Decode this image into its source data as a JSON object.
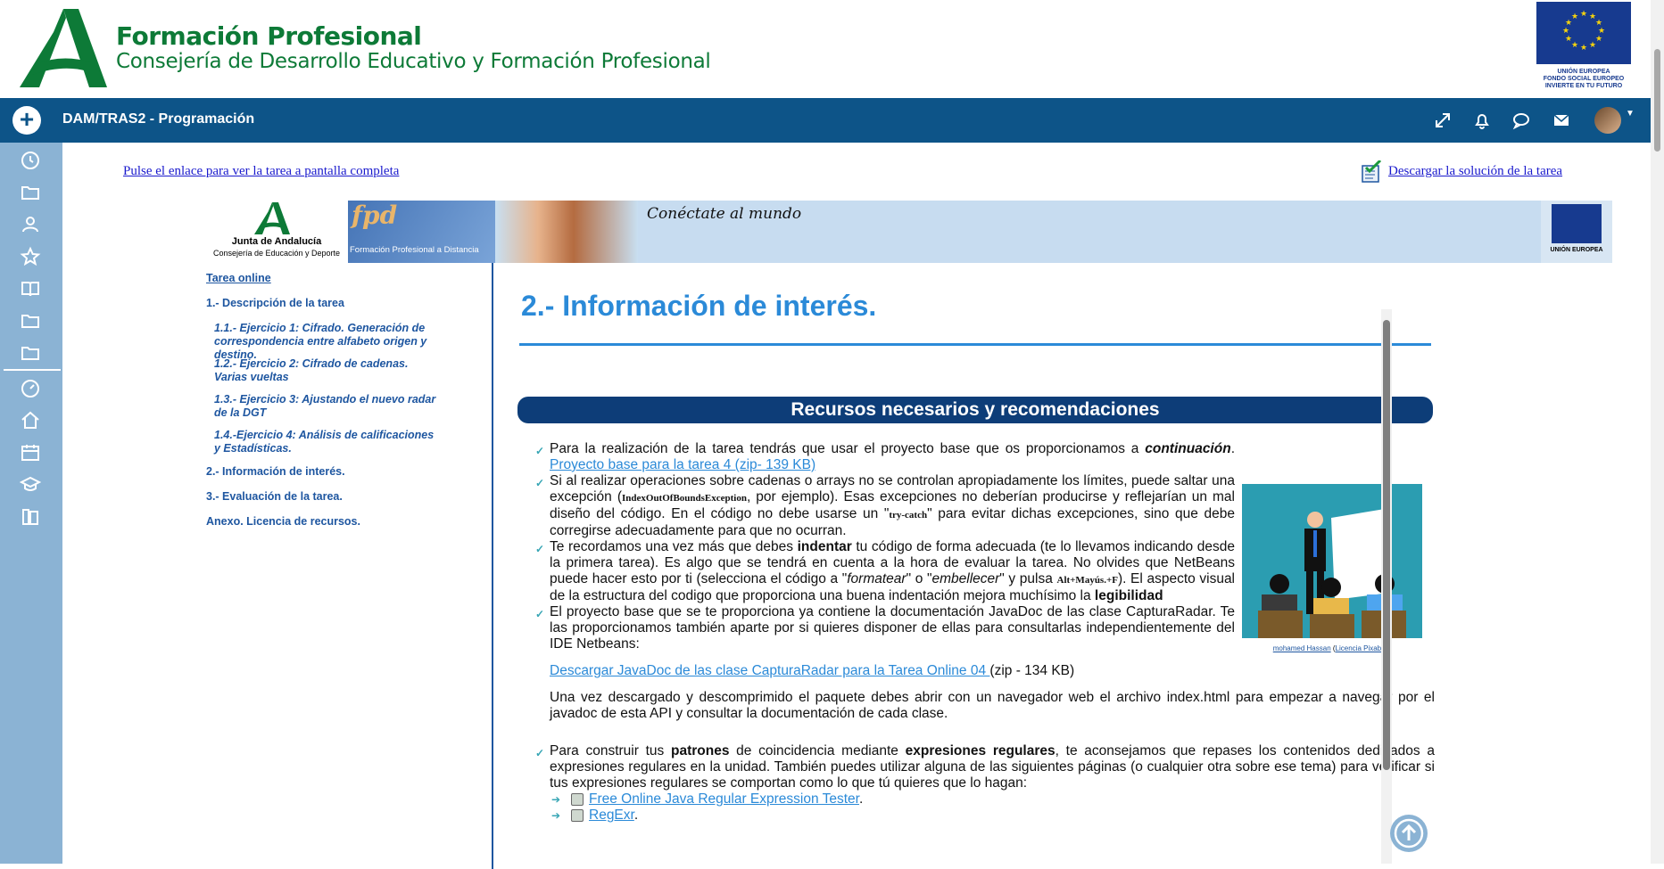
{
  "header": {
    "title": "Formación Profesional",
    "subtitle": "Consejería de Desarrollo Educativo y Formación Profesional",
    "eu_text_1": "UNIÓN EUROPEA",
    "eu_text_2": "FONDO SOCIAL EUROPEO",
    "eu_text_3": "INVIERTE EN TU FUTURO"
  },
  "navbar": {
    "course_title": "DAM/TRAS2 - Programación",
    "icons": [
      "expand-icon",
      "bell-icon",
      "chat-icon",
      "mail-icon"
    ]
  },
  "rail": {
    "icons": [
      "clock-icon",
      "folder-icon",
      "users-icon",
      "star-icon",
      "book-icon",
      "folder-icon",
      "folder-icon",
      "gauge-icon",
      "home-icon",
      "calendar-icon",
      "graduation-icon",
      "library-icon"
    ]
  },
  "content": {
    "fullscreen_link": "Pulse el enlace para ver la tarea a pantalla completa",
    "solution_link": "Descargar la solución de la tarea",
    "banner": {
      "ja_name": "Junta de Andalucía",
      "ja_sub": "Consejería de Educación y Deporte",
      "fpd_label": "Formación Profesional a Distancia",
      "slogan": "Conéctate al mundo",
      "eu_label": "UNIÓN EUROPEA"
    },
    "toc": [
      {
        "label": "Tarea online",
        "type": "title"
      },
      {
        "label": "1.- Descripción de la tarea",
        "type": "item"
      },
      {
        "label": "1.1.- Ejercicio 1: Cifrado. Generación de correspondencia entre alfabeto origen y destino.",
        "type": "sub"
      },
      {
        "label": "1.2.- Ejercicio 2: Cifrado de cadenas. Varias vueltas",
        "type": "sub"
      },
      {
        "label": "1.3.- Ejercicio 3: Ajustando el nuevo radar de la DGT",
        "type": "sub"
      },
      {
        "label": "1.4.-Ejercicio 4: Análisis de calificaciones y Estadísticas.",
        "type": "sub"
      },
      {
        "label": "2.- Información de interés.",
        "type": "item"
      },
      {
        "label": "3.- Evaluación de la tarea.",
        "type": "item"
      },
      {
        "label": "Anexo. Licencia de recursos.",
        "type": "item"
      }
    ],
    "heading": "2.- Información de interés.",
    "section_bar": "Recursos necesarios y recomendaciones",
    "bullets": {
      "b1_text": "Para la realización de la tarea tendrás que usar el proyecto base que os proporcionamos a ",
      "b1_em": "continuación",
      "b1_link": "Proyecto base para la tarea 4 (zip- 139 KB)",
      "b2_a": "Si al realizar operaciones sobre cadenas o arrays no se controlan apropiadamente los límites, puede saltar una excepción (",
      "b2_code": "IndexOutOfBoundsException",
      "b2_b": ", por ejemplo). Esas excepciones no deberían producirse y reflejarían un mal diseño del código. En el código no debe usarse un \"",
      "b2_code2": "try-catch",
      "b2_c": "\" para evitar dichas excepciones, sino que debe corregirse adecuadamente para que no ocurran.",
      "b3_a": "Te recordamos una vez más que debes ",
      "b3_strong": "indentar",
      "b3_b": " tu código de forma adecuada (te lo llevamos indicando desde la primera tarea). Es algo que se tendrá en cuenta a la hora de evaluar la tarea. No olvides que NetBeans puede hacer esto por ti (selecciona el código a \"",
      "b3_em1": "formatear",
      "b3_c": "\" o \"",
      "b3_em2": "embellecer",
      "b3_d": "\" y pulsa ",
      "b3_keys": "Alt+Mayús.+F",
      "b3_e": "). El aspecto visual de la estructura del codigo que proporciona una buena indentación mejora muchísimo la ",
      "b3_strong2": "legibilidad",
      "b4_a": "El proyecto base que se te proporciona ya contiene la documentación JavaDoc de las clase CapturaRadar. Te las proporcionamos también aparte por si quieres disponer de ellas para consultarlas independientemente del IDE Netbeans:",
      "b4_link": "Descargar JavaDoc de las clase CapturaRadar para la Tarea Online 04 ",
      "b4_size": "(zip - 134 KB)",
      "b4_after": "Una vez descargado y descomprimido el paquete debes abrir con un navegador web el archivo index.html para empezar a navegar por el javadoc de esta API y consultar la documentación de cada clase.",
      "b5_a": "Para construir tus ",
      "b5_s1": "patrones",
      "b5_b": " de coincidencia mediante ",
      "b5_s2": "expresiones regulares",
      "b5_c": ", te aconsejamos que repases los contenidos dedicados a expresiones regulares en la unidad. También puedes utilizar alguna de las siguientes páginas (o cualquier otra sobre ese tema) para verificar si tus expresiones regulares se comportan como lo que tú quieres que lo hagan:",
      "sub1": "Free Online Java Regular Expression Tester",
      "sub2": "RegExr"
    },
    "figure_caption_author": "mohamed Hassan",
    "figure_caption_license": "Licencia Pixabay"
  },
  "colors": {
    "brand_green": "#0d7a37",
    "navbar": "#0d5488",
    "rail": "#8bb3d4",
    "heading_blue": "#2b8ad8",
    "bar_dark": "#0d3d78"
  }
}
